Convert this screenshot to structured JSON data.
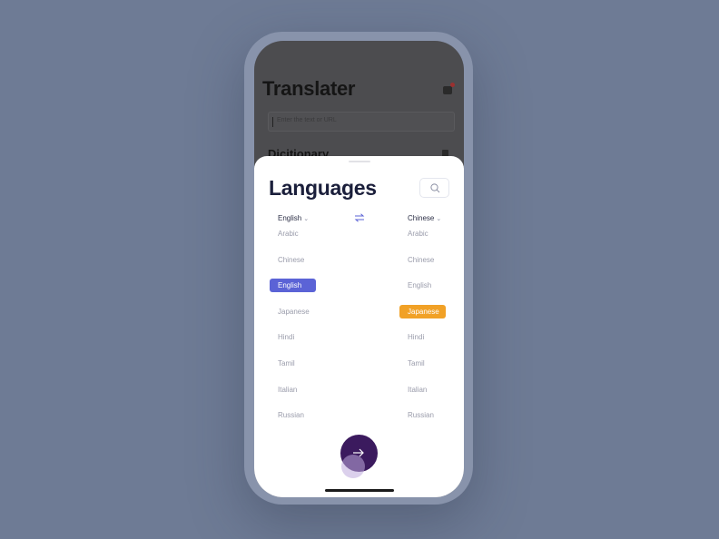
{
  "background_app": {
    "title": "Translater",
    "search_placeholder": "Enter the text or URL",
    "section_title": "Dicitionary"
  },
  "sheet": {
    "title": "Languages",
    "source_language": "English",
    "target_language": "Chinese",
    "source_list": [
      {
        "label": "Arabic"
      },
      {
        "label": "Chinese"
      },
      {
        "label": "English",
        "selected": true
      },
      {
        "label": "Japanese"
      },
      {
        "label": "Hindi"
      },
      {
        "label": "Tamil"
      },
      {
        "label": "Italian"
      },
      {
        "label": "Russian"
      }
    ],
    "target_list": [
      {
        "label": "Arabic"
      },
      {
        "label": "Chinese"
      },
      {
        "label": "English"
      },
      {
        "label": "Japanese",
        "selected": true
      },
      {
        "label": "Hindi"
      },
      {
        "label": "Tamil"
      },
      {
        "label": "Italian"
      },
      {
        "label": "Russian"
      }
    ]
  },
  "icons": {
    "search": "search-icon",
    "swap": "swap-icon",
    "next": "arrow-right-icon",
    "cart": "cart-icon",
    "book": "book-icon"
  },
  "colors": {
    "source_selected": "#5b63d6",
    "target_selected": "#f1a126",
    "fab": "#3b1a5e",
    "title": "#1b1f3b"
  }
}
